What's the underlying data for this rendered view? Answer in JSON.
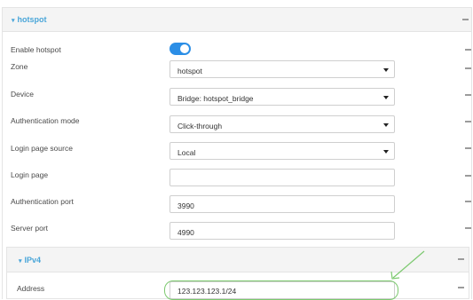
{
  "section": {
    "title": "hotspot",
    "expand_glyph": "▾"
  },
  "rows": {
    "enable_hotspot": {
      "label": "Enable hotspot"
    },
    "zone": {
      "label": "Zone",
      "value": "hotspot"
    },
    "device": {
      "label": "Device",
      "value": "Bridge: hotspot_bridge"
    },
    "auth_mode": {
      "label": "Authentication mode",
      "value": "Click-through"
    },
    "login_source": {
      "label": "Login page source",
      "value": "Local"
    },
    "login_page": {
      "label": "Login page",
      "value": ""
    },
    "auth_port": {
      "label": "Authentication port",
      "value": "3990"
    },
    "server_port": {
      "label": "Server port",
      "value": "4990"
    }
  },
  "ipv4": {
    "title": "IPv4",
    "expand_glyph": "▾",
    "address": {
      "label": "Address",
      "value": "123.123.123.1/24"
    }
  },
  "colors": {
    "accent": "#4aa6d9",
    "toggle_on": "#2b8ee6",
    "highlight": "#7cc96f"
  },
  "icons": [
    "expand-triangle-icon",
    "collapse-icon",
    "dropdown-caret-icon",
    "callout-arrow-icon"
  ]
}
